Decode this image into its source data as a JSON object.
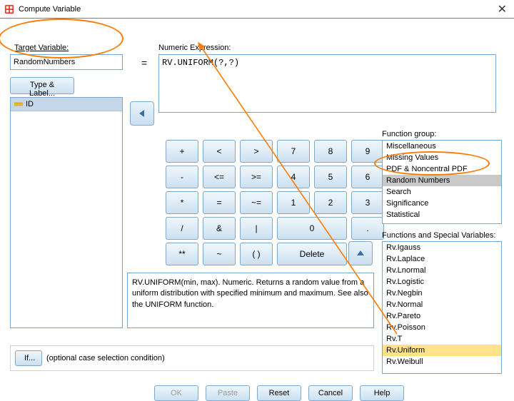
{
  "window": {
    "title": "Compute Variable"
  },
  "target": {
    "label": "Target Variable:",
    "value": "RandomNumbers",
    "type_label_btn": "Type & Label..."
  },
  "equals": "=",
  "expression": {
    "label": "Numeric Expression:",
    "value": "RV.UNIFORM(?,?)"
  },
  "var_list": {
    "header": "ID"
  },
  "keypad": {
    "r0": [
      "+",
      "<",
      ">",
      "7",
      "8",
      "9"
    ],
    "r1": [
      "-",
      "<=",
      ">=",
      "4",
      "5",
      "6"
    ],
    "r2": [
      "*",
      "=",
      "~=",
      "1",
      "2",
      "3"
    ],
    "r3": [
      "/",
      "&",
      "|",
      "0",
      "."
    ],
    "r4": [
      "**",
      "~",
      "( )",
      "Delete"
    ]
  },
  "function_group": {
    "label": "Function group:",
    "items": [
      "Miscellaneous",
      "Missing Values",
      "PDF & Noncentral PDF",
      "Random Numbers",
      "Search",
      "Significance",
      "Statistical"
    ],
    "selected_index": 3
  },
  "functions": {
    "label": "Functions and Special Variables:",
    "items": [
      "Rv.Igauss",
      "Rv.Laplace",
      "Rv.Lnormal",
      "Rv.Logistic",
      "Rv.Negbin",
      "Rv.Normal",
      "Rv.Pareto",
      "Rv.Poisson",
      "Rv.T",
      "Rv.Uniform",
      "Rv.Weibull"
    ],
    "selected_index": 9
  },
  "description": "RV.UNIFORM(min, max). Numeric. Returns a random value from a uniform distribution with specified minimum and maximum. See also the UNIFORM function.",
  "if_row": {
    "btn": "If...",
    "text": "(optional case selection condition)"
  },
  "buttons": {
    "ok": "OK",
    "paste": "Paste",
    "reset": "Reset",
    "cancel": "Cancel",
    "help": "Help"
  }
}
